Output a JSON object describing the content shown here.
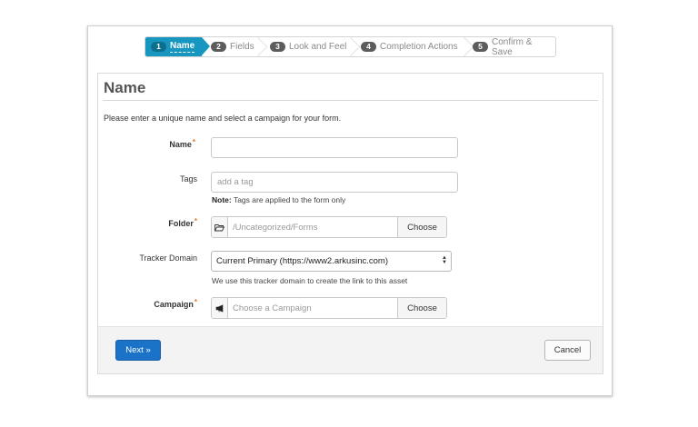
{
  "wizard": {
    "steps": [
      {
        "num": "1",
        "label": "Name"
      },
      {
        "num": "2",
        "label": "Fields"
      },
      {
        "num": "3",
        "label": "Look and Feel"
      },
      {
        "num": "4",
        "label": "Completion Actions"
      },
      {
        "num": "5",
        "label": "Confirm & Save"
      }
    ],
    "active_step": 1
  },
  "panel": {
    "title": "Name",
    "intro": "Please enter a unique name and select a campaign for your form."
  },
  "form": {
    "name": {
      "label": "Name",
      "value": ""
    },
    "tags": {
      "label": "Tags",
      "placeholder": "add a tag",
      "note_bold": "Note:",
      "note": " Tags are applied to the form only"
    },
    "folder": {
      "label": "Folder",
      "value": "/Uncategorized/Forms",
      "button": "Choose"
    },
    "tracker": {
      "label": "Tracker Domain",
      "selected": "Current Primary (https://www2.arkusinc.com)",
      "note": "We use this tracker domain to create the link to this asset"
    },
    "campaign": {
      "label": "Campaign",
      "placeholder": "Choose a Campaign",
      "button": "Choose"
    },
    "required_mark": "*"
  },
  "footer": {
    "next": "Next »",
    "cancel": "Cancel"
  },
  "colors": {
    "active_step": "#1797c0",
    "primary_button": "#1a73c8",
    "required": "#e87722"
  },
  "icons": {
    "folder": "folder-open-icon",
    "campaign": "megaphone-icon"
  }
}
